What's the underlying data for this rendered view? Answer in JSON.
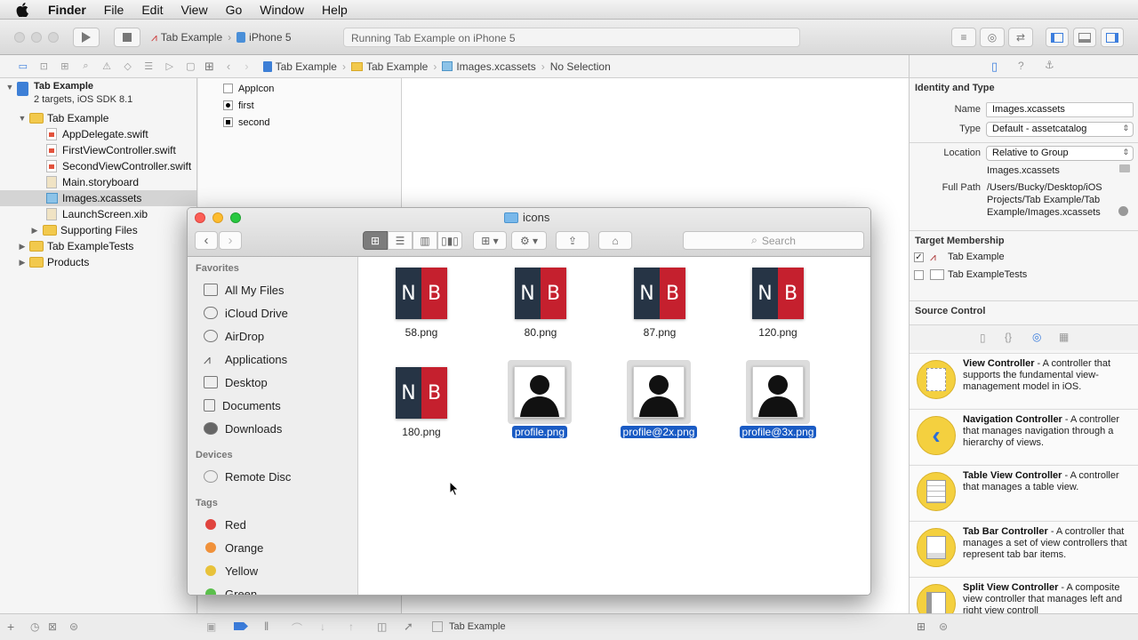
{
  "menubar": {
    "app": "Finder",
    "items": [
      "File",
      "Edit",
      "View",
      "Go",
      "Window",
      "Help"
    ]
  },
  "toolbar": {
    "scheme": "Tab Example",
    "device": "iPhone 5",
    "status": "Running Tab Example on iPhone 5"
  },
  "navigator": {
    "project": "Tab Example",
    "project_sub": "2 targets, iOS SDK 8.1",
    "group": "Tab Example",
    "files": [
      "AppDelegate.swift",
      "FirstViewController.swift",
      "SecondViewController.swift",
      "Main.storyboard",
      "Images.xcassets",
      "LaunchScreen.xib"
    ],
    "supporting": "Supporting Files",
    "tests": "Tab ExampleTests",
    "products": "Products"
  },
  "jumpbar": {
    "c1": "Tab Example",
    "c2": "Tab Example",
    "c3": "Images.xcassets",
    "c4": "No Selection"
  },
  "assets": [
    "AppIcon",
    "first",
    "second"
  ],
  "inspector": {
    "identity_title": "Identity and Type",
    "name_label": "Name",
    "name_value": "Images.xcassets",
    "type_label": "Type",
    "type_value": "Default - assetcatalog",
    "location_label": "Location",
    "location_value": "Relative to Group",
    "location_file": "Images.xcassets",
    "fullpath_label": "Full Path",
    "fullpath_value": "/Users/Bucky/Desktop/iOS Projects/Tab Example/Tab Example/Images.xcassets",
    "target_title": "Target Membership",
    "target1": "Tab Example",
    "target2": "Tab ExampleTests",
    "source_title": "Source Control"
  },
  "library": [
    {
      "title": "View Controller",
      "desc": " - A controller that supports the fundamental view-management model in iOS."
    },
    {
      "title": "Navigation Controller",
      "desc": " - A controller that manages navigation through a hierarchy of views."
    },
    {
      "title": "Table View Controller",
      "desc": " - A controller that manages a table view."
    },
    {
      "title": "Tab Bar Controller",
      "desc": " - A controller that manages a set of view controllers that represent tab bar items."
    },
    {
      "title": "Split View Controller",
      "desc": " - A composite view controller that manages left and right view controll"
    }
  ],
  "debug_bar": {
    "target": "Tab Example"
  },
  "finder": {
    "title": "icons",
    "search_placeholder": "Search",
    "favorites_head": "Favorites",
    "favorites": [
      "All My Files",
      "iCloud Drive",
      "AirDrop",
      "Applications",
      "Desktop",
      "Documents",
      "Downloads"
    ],
    "devices_head": "Devices",
    "devices": [
      "Remote Disc"
    ],
    "tags_head": "Tags",
    "tags": [
      {
        "name": "Red",
        "color": "#e0443e"
      },
      {
        "name": "Orange",
        "color": "#f0913a"
      },
      {
        "name": "Yellow",
        "color": "#e8c23a"
      },
      {
        "name": "Green",
        "color": "#5bbf4c"
      }
    ],
    "files": [
      {
        "name": "58.png",
        "kind": "nb",
        "selected": false
      },
      {
        "name": "80.png",
        "kind": "nb",
        "selected": false
      },
      {
        "name": "87.png",
        "kind": "nb",
        "selected": false
      },
      {
        "name": "120.png",
        "kind": "nb",
        "selected": false
      },
      {
        "name": "180.png",
        "kind": "nb",
        "selected": false
      },
      {
        "name": "profile.png",
        "kind": "profile",
        "selected": true
      },
      {
        "name": "profile@2x.png",
        "kind": "profile",
        "selected": true
      },
      {
        "name": "profile@3x.png",
        "kind": "profile",
        "selected": true
      }
    ],
    "nb_letters": [
      "N",
      "B"
    ]
  },
  "colors": {
    "selection": "#1a5bc4",
    "nb_dark": "#263445",
    "nb_red": "#c5202e"
  }
}
